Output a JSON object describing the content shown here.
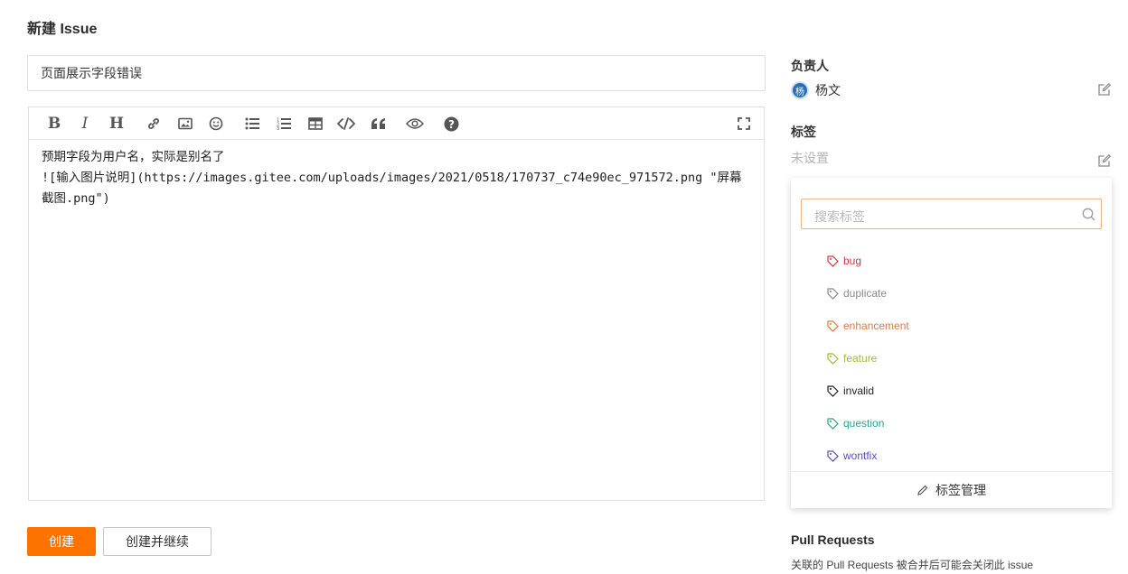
{
  "page": {
    "title": "新建 Issue"
  },
  "issue": {
    "title_value": "页面展示字段错误",
    "body": "预期字段为用户名，实际是别名了\n![输入图片说明](https://images.gitee.com/uploads/images/2021/0518/170737_c74e90ec_971572.png \"屏幕截图.png\")"
  },
  "toolbar": {
    "items": [
      "bold-icon",
      "italic-icon",
      "heading-icon",
      "link-icon",
      "image-icon",
      "emoji-icon",
      "unordered-list-icon",
      "ordered-list-icon",
      "table-icon",
      "code-icon",
      "quote-icon",
      "preview-icon",
      "help-icon",
      "fullscreen-icon"
    ],
    "bold_glyph": "B",
    "italic_glyph": "I",
    "heading_glyph": "H"
  },
  "actions": {
    "create": "创建",
    "create_continue": "创建并继续"
  },
  "sidebar": {
    "assignee_label": "负责人",
    "assignee_avatar": "杨",
    "assignee_name": "杨文",
    "labels_label": "标签",
    "labels_value": "未设置",
    "dropdown": {
      "search_placeholder": "搜索标签",
      "labels": [
        {
          "name": "bug",
          "color": "#d13c3c"
        },
        {
          "name": "duplicate",
          "color": "#8a8a8a"
        },
        {
          "name": "enhancement",
          "color": "#e07a3c"
        },
        {
          "name": "feature",
          "color": "#9cbd3c"
        },
        {
          "name": "invalid",
          "color": "#222222"
        },
        {
          "name": "question",
          "color": "#2aa58e"
        },
        {
          "name": "wontfix",
          "color": "#5b4eb8"
        }
      ],
      "manage_label": "标签管理"
    },
    "pr_title": "Pull Requests",
    "pr_desc": "关联的 Pull Requests 被合并后可能会关闭此 issue"
  },
  "colors": {
    "accent": "#fe7300",
    "avatar": "#2a6eb5"
  }
}
